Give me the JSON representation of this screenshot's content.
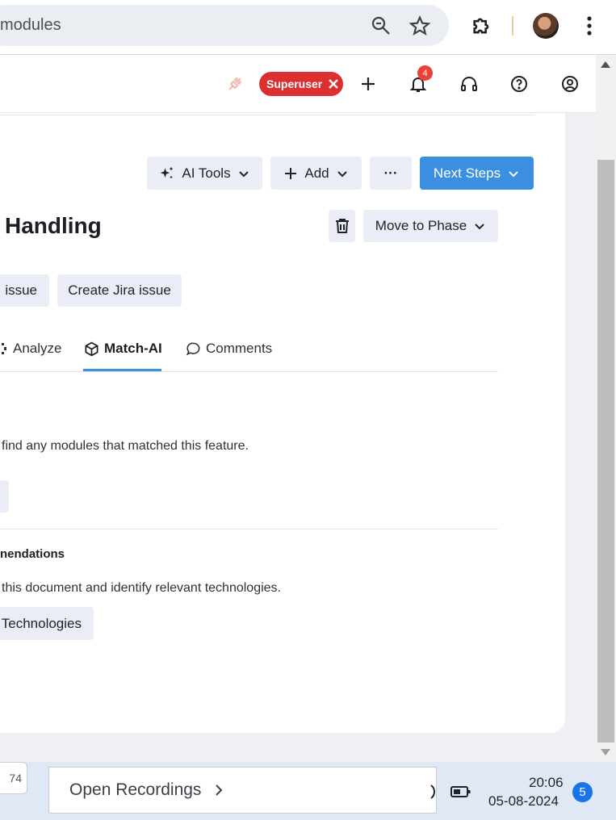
{
  "browser": {
    "url_fragment": "modules",
    "icons": [
      "zoom-icon",
      "bookmark-star-icon",
      "extensions-icon",
      "profile-avatar",
      "menu-dots-icon"
    ]
  },
  "header": {
    "superuser_label": "Superuser",
    "notification_count": "4",
    "icons": [
      "plug-icon",
      "close-icon",
      "plus-icon",
      "bell-icon",
      "headset-icon",
      "help-icon",
      "account-icon"
    ]
  },
  "toolbar": {
    "ai_tools_label": "AI Tools",
    "add_label": "Add",
    "more_label": "···",
    "next_steps_label": "Next Steps"
  },
  "feature": {
    "title": "Handling",
    "move_to_phase_label": "Move to Phase",
    "issue_button_label": "issue",
    "jira_button_label": "Create Jira issue"
  },
  "tabs": [
    {
      "label": "Analyze",
      "active": false
    },
    {
      "label": "Match-AI",
      "active": true
    },
    {
      "label": "Comments",
      "active": false
    }
  ],
  "match_section": {
    "message": "find any modules that matched this feature."
  },
  "recommendations": {
    "heading": "nendations",
    "description": "this document and identify relevant technologies.",
    "button_label": "Technologies"
  },
  "taskbar": {
    "left_tile_text": "74",
    "open_recordings_label": "Open Recordings",
    "time": "20:06",
    "date": "05-08-2024",
    "notification_count": "5"
  },
  "colors": {
    "primary": "#3b8fe0",
    "superuser_badge": "#dc2f2f",
    "notification": "#ea4335"
  }
}
